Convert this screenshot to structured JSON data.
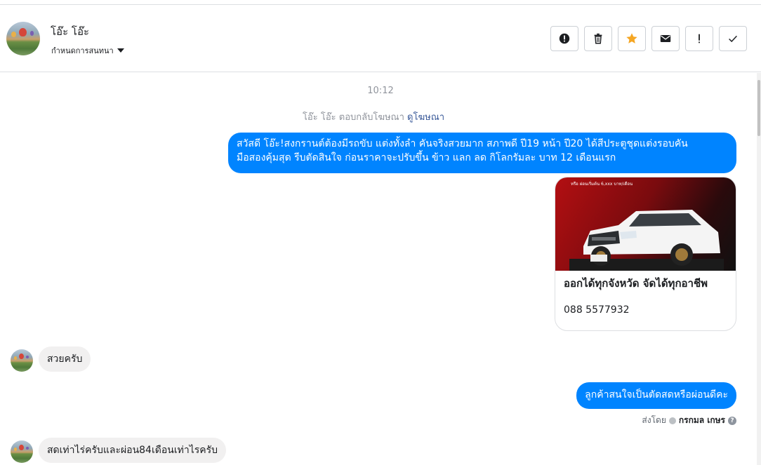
{
  "contact": {
    "name": "โอ๊ะ โอ๊ะ",
    "assign_label": "กำหนดการสนทนา"
  },
  "toolbar": {
    "buttons": [
      {
        "icon": "alert-circle-icon"
      },
      {
        "icon": "trash-icon"
      },
      {
        "icon": "star-icon"
      },
      {
        "icon": "envelope-icon"
      },
      {
        "icon": "exclamation-icon"
      },
      {
        "icon": "checkmark-icon"
      }
    ],
    "star_color": "#f5a623"
  },
  "conversation": {
    "time": "10:12",
    "ad_reply_prefix": "โอ๊ะ โอ๊ะ ตอบกลับโฆษณา",
    "ad_reply_link": "ดูโฆษณา",
    "messages": [
      {
        "side": "out",
        "text_line1": "สวัสดี โอ๊ะ!สงกรานต์ต้องมีรถขับ แต่งทั้งลำ คันจริงสวยมาก สภาพดี ปี19 หน้า ปี20 ได้สีประตูชุดแต่งรอบคัน",
        "text_line2": "มือสองคุ้มสุด รีบตัดสินใจ ก่อนราคาจะปรับขึ้น ข้าว แลก ลด กิโลกรัมละ บาท 12 เดือนแรก"
      },
      {
        "side": "in",
        "text": "สวยครับ"
      },
      {
        "side": "out",
        "text": "ลูกค้าสนใจเป็นตัดสดหรือผ่อนดีคะ"
      },
      {
        "side": "in",
        "text": "สดเท่าไร่ครับและผ่อน84เดือนเท่าไรครับ"
      }
    ],
    "card": {
      "promo_text": "หรือ ผ่อนเริ่มต้น 6,xxx บาท/เดือน",
      "title": "ออกได้ทุกจังหวัด จัดได้ทุกอาชีพ",
      "phone": "088 5577932"
    },
    "sent_by_label": "ส่งโดย",
    "sent_by_name": "กรกมล เกษร"
  },
  "colors": {
    "outgoing_bubble": "#0084ff",
    "incoming_bubble": "#f1f0f0",
    "link": "#385898"
  }
}
